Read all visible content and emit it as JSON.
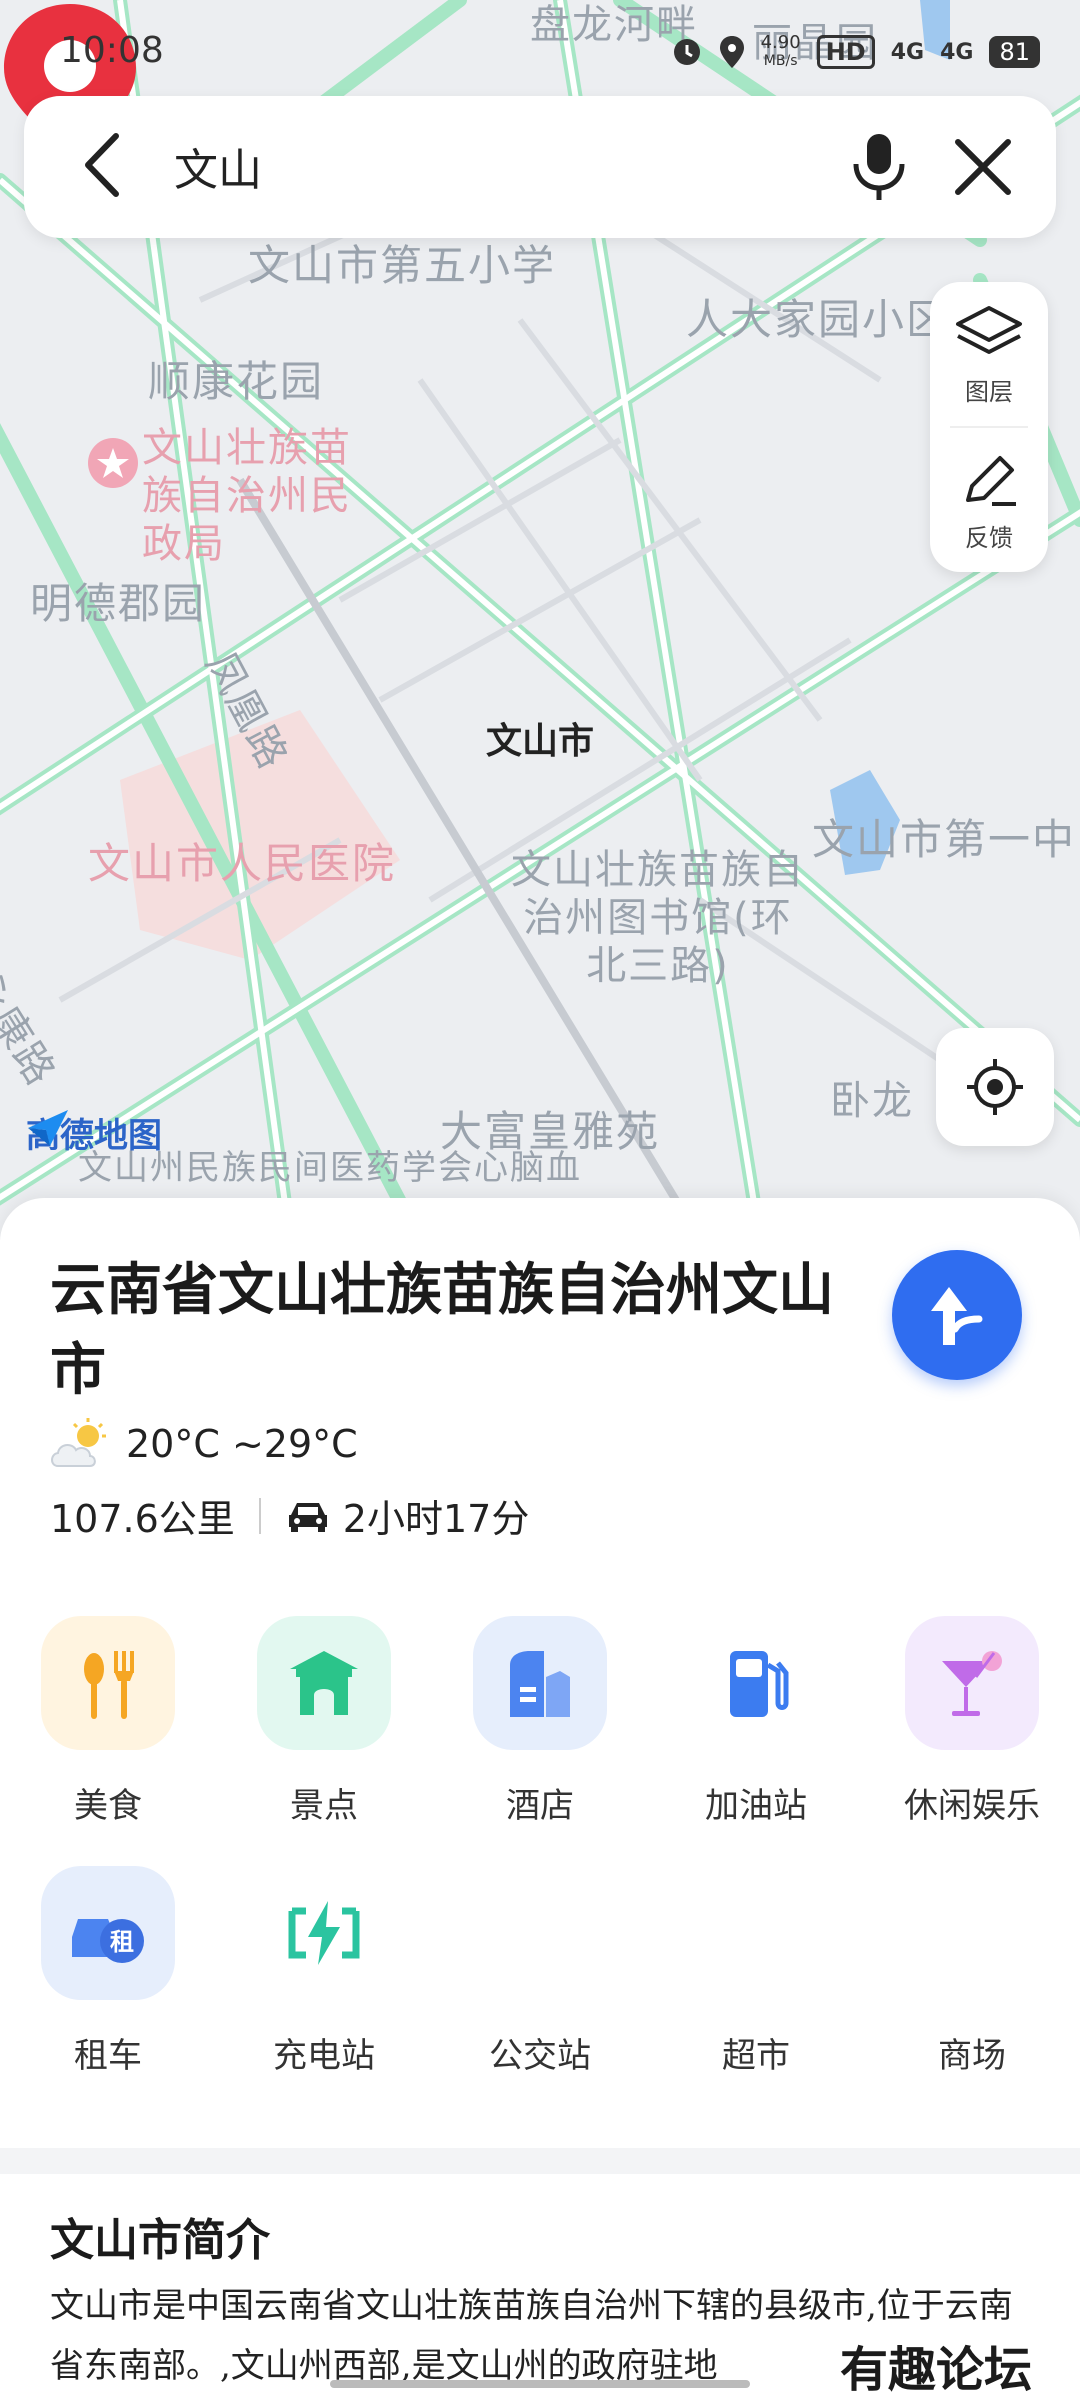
{
  "status_bar": {
    "time": "10:08",
    "speed": "4.90",
    "speed_unit": "MB/s",
    "hd": "HD",
    "net1": "4G",
    "net2": "4G",
    "battery": "81"
  },
  "search": {
    "query": "文山"
  },
  "map": {
    "labels": {
      "panlong": "盘龙河畔",
      "liyuan": "丽晶园",
      "school5": "文山市第五小学",
      "renda": "人大家园小区",
      "shunkang": "顺康花园",
      "minzheng": "文山壮族苗族自治州民政局",
      "mingde": "明德郡园",
      "fenghuang": "凤凰路",
      "hospital": "文山市人民医院",
      "library": "文山壮族苗族自治州图书馆(环北三路)",
      "no1": "文山市第一中",
      "yongkang": "永康路",
      "wolong": "卧龙",
      "dafu": "大富皇雅苑",
      "minzu": "文山州民族民间医药学会心脑血"
    },
    "pin_label": "文山市",
    "logo_text": "高德地图"
  },
  "tools": {
    "layers_label": "图层",
    "feedback_label": "反馈"
  },
  "place": {
    "title": "云南省文山壮族苗族自治州文山市",
    "weather": "20°C ~29°C",
    "distance": "107.6公里",
    "drive_time": "2小时17分"
  },
  "categories": [
    {
      "label": "美食",
      "icon": "food-icon"
    },
    {
      "label": "景点",
      "icon": "scenic-icon"
    },
    {
      "label": "酒店",
      "icon": "hotel-icon"
    },
    {
      "label": "加油站",
      "icon": "gas-station-icon"
    },
    {
      "label": "休闲娱乐",
      "icon": "leisure-icon"
    },
    {
      "label": "租车",
      "icon": "car-rental-icon"
    },
    {
      "label": "充电站",
      "icon": "charging-icon"
    },
    {
      "label": "公交站",
      "icon": "bus-stop-icon"
    },
    {
      "label": "超市",
      "icon": "supermarket-icon"
    },
    {
      "label": "商场",
      "icon": "mall-icon"
    }
  ],
  "intro": {
    "title": "文山市简介",
    "text": "文山市是中国云南省文山壮族苗族自治州下辖的县级市,位于云南省东南部。,文山州西部,是文山州的政府驻地"
  },
  "watermark": "有趣论坛",
  "colors": {
    "accent": "#2f6df0",
    "pin": "#e8313f",
    "road": "#9fe3c0",
    "map_bg": "#eceef1"
  }
}
